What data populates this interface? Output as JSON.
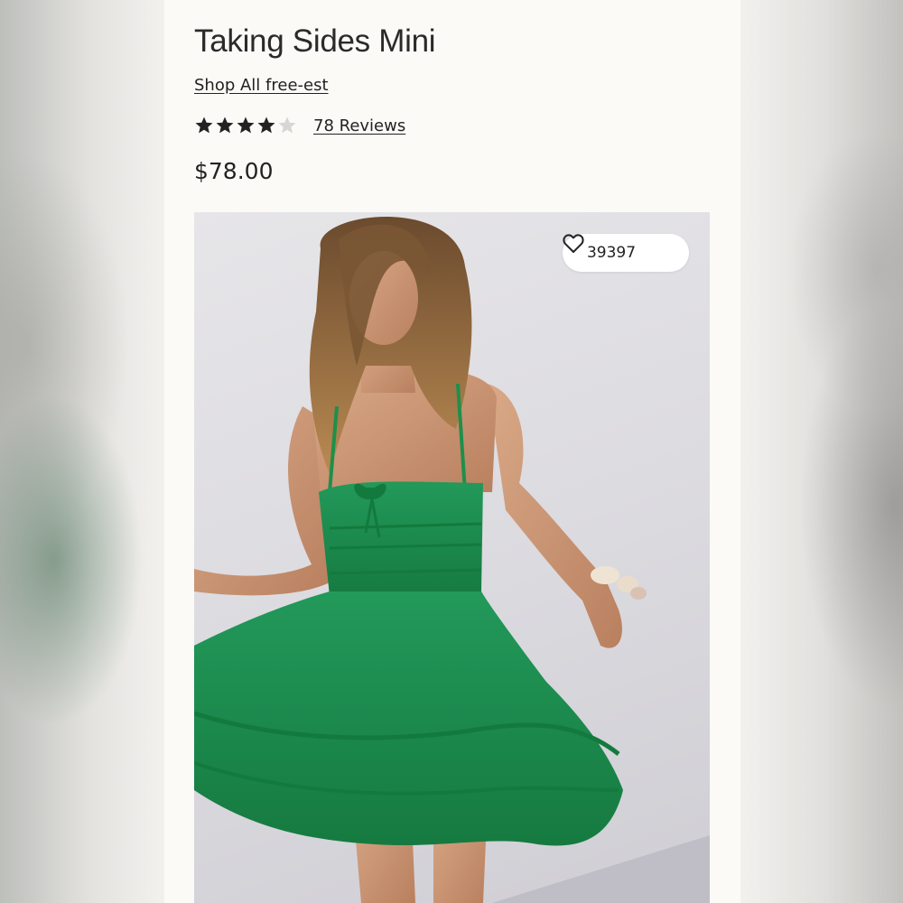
{
  "product": {
    "title": "Taking Sides Mini",
    "shop_all_label": "Shop All free-est",
    "rating": 4,
    "rating_max": 5,
    "reviews_label": "78 Reviews",
    "price": "$78.00"
  },
  "image": {
    "subject": "model in green tiered mini dress",
    "favorites_count": "39397",
    "favorite_icon": "heart-outline-icon"
  },
  "colors": {
    "panel_bg": "#fcfaf7",
    "text": "#222222",
    "star_filled": "#222222",
    "star_empty": "#d6d6d6",
    "dress_green": "#1e8f4c"
  }
}
